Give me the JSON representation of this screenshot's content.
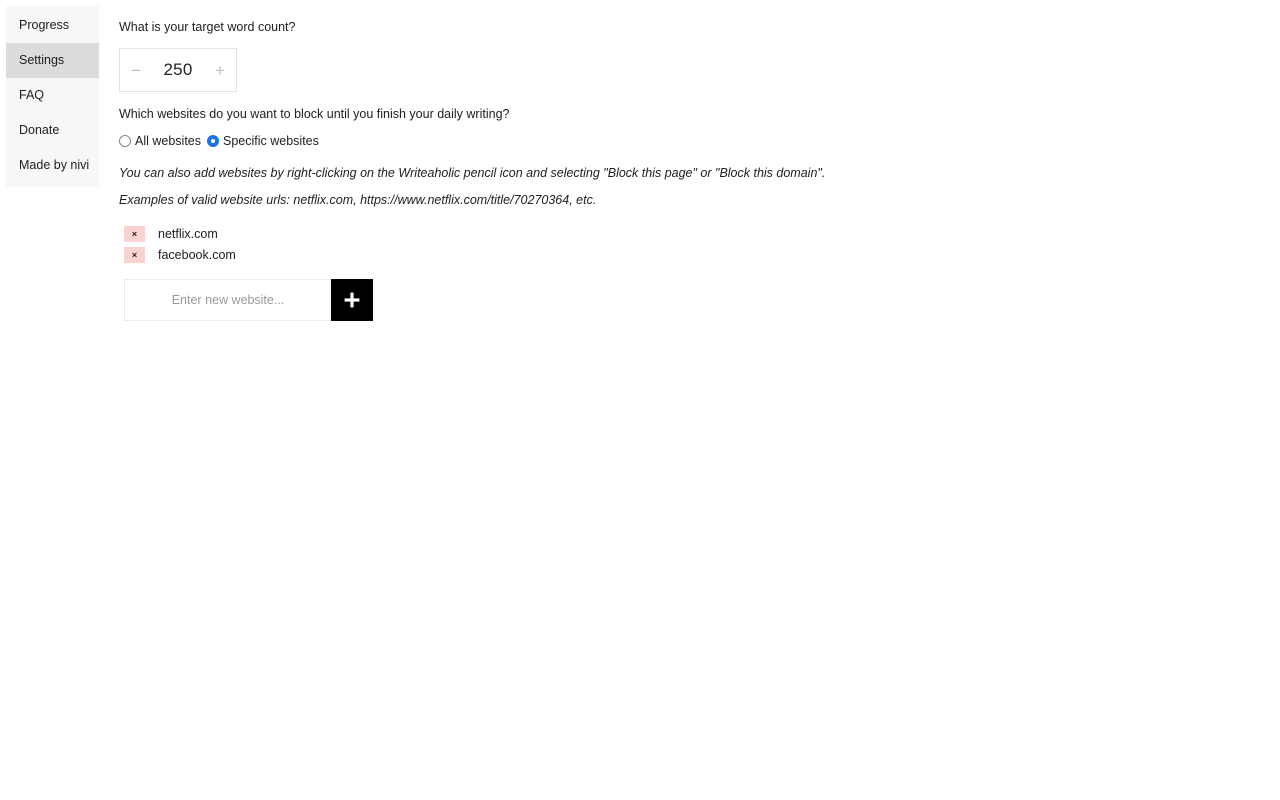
{
  "sidebar": {
    "items": [
      {
        "label": "Progress",
        "name": "sidebar-item-progress",
        "active": false
      },
      {
        "label": "Settings",
        "name": "sidebar-item-settings",
        "active": true
      },
      {
        "label": "FAQ",
        "name": "sidebar-item-faq",
        "active": false
      },
      {
        "label": "Donate",
        "name": "sidebar-item-donate",
        "active": false
      },
      {
        "label": "Made by nivi",
        "name": "sidebar-item-made-by-nivi",
        "active": false
      }
    ]
  },
  "settings": {
    "word_count": {
      "label": "What is your target word count?",
      "value": "250",
      "decrement_label": "−",
      "increment_label": "+"
    },
    "block_sites": {
      "label": "Which websites do you want to block until you finish your daily writing?",
      "options": [
        {
          "label": "All websites",
          "selected": false
        },
        {
          "label": "Specific websites",
          "selected": true
        }
      ],
      "hints": [
        "You can also add websites by right-clicking on the Writeaholic pencil icon and selecting \"Block this page\" or \"Block this domain\".",
        "Examples of valid website urls: netflix.com, https://www.netflix.com/title/70270364, etc."
      ],
      "blocked_websites": [
        {
          "name": "netflix.com",
          "remove_label": "×"
        },
        {
          "name": "facebook.com",
          "remove_label": "×"
        }
      ],
      "new_website_placeholder": "Enter new website...",
      "new_website_value": "",
      "add_button_icon": "plus-icon"
    }
  },
  "colors": {
    "sidebar_background": "#f7f7f7",
    "sidebar_active": "#dcdcdc",
    "radio_accent": "#1a73e8",
    "remove_chip": "#fbd2d2",
    "add_button": "#000000",
    "page_background": "#ffffff"
  }
}
